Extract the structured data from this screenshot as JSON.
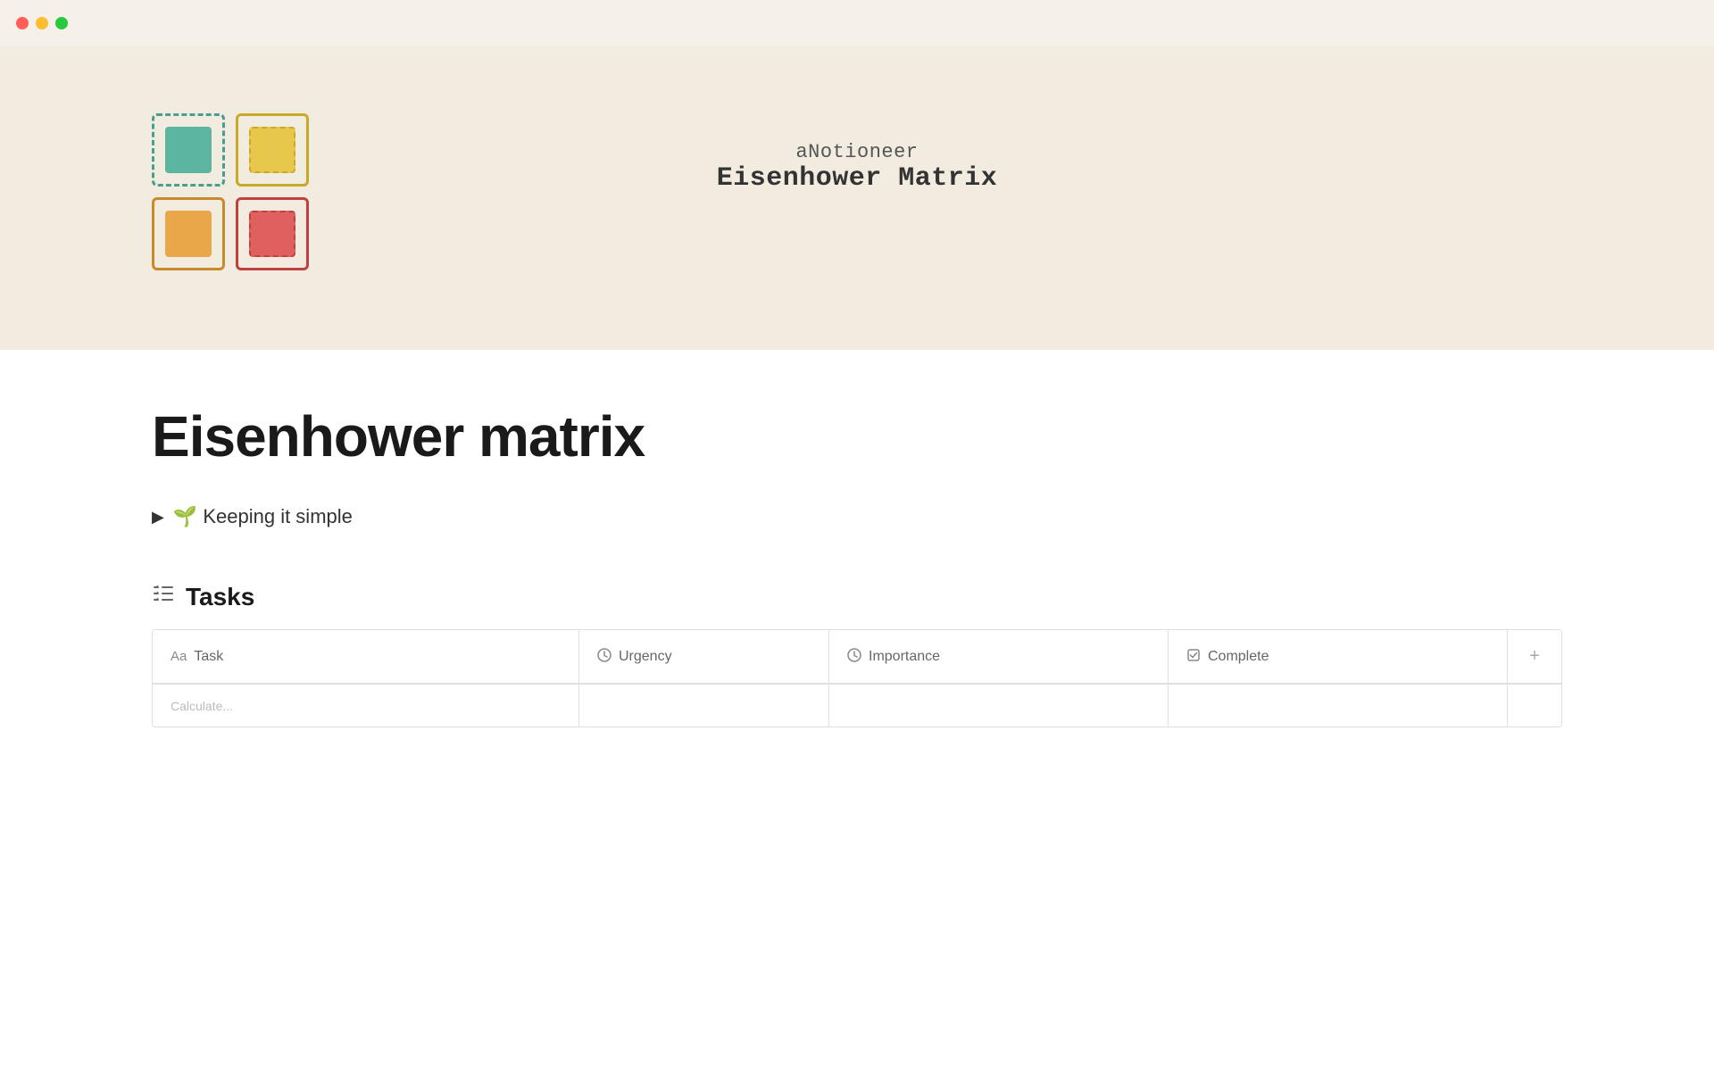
{
  "titlebar": {
    "traffic_lights": [
      "red",
      "yellow",
      "green"
    ]
  },
  "banner": {
    "subtitle": "aNotioneer",
    "title": "Eisenhower Matrix",
    "squares": [
      {
        "id": "teal",
        "color": "teal"
      },
      {
        "id": "yellow",
        "color": "yellow"
      },
      {
        "id": "orange",
        "color": "orange"
      },
      {
        "id": "red",
        "color": "red"
      }
    ]
  },
  "page": {
    "title": "Eisenhower matrix",
    "toggle_label": "🌱 Keeping it simple"
  },
  "tasks_section": {
    "icon": "≔",
    "title": "Tasks",
    "table": {
      "columns": [
        {
          "icon": "Aa",
          "label": "Task"
        },
        {
          "icon": "◎",
          "label": "Urgency"
        },
        {
          "icon": "◎",
          "label": "Importance"
        },
        {
          "icon": "☑",
          "label": "Complete"
        },
        {
          "icon": "+",
          "label": ""
        }
      ]
    }
  }
}
